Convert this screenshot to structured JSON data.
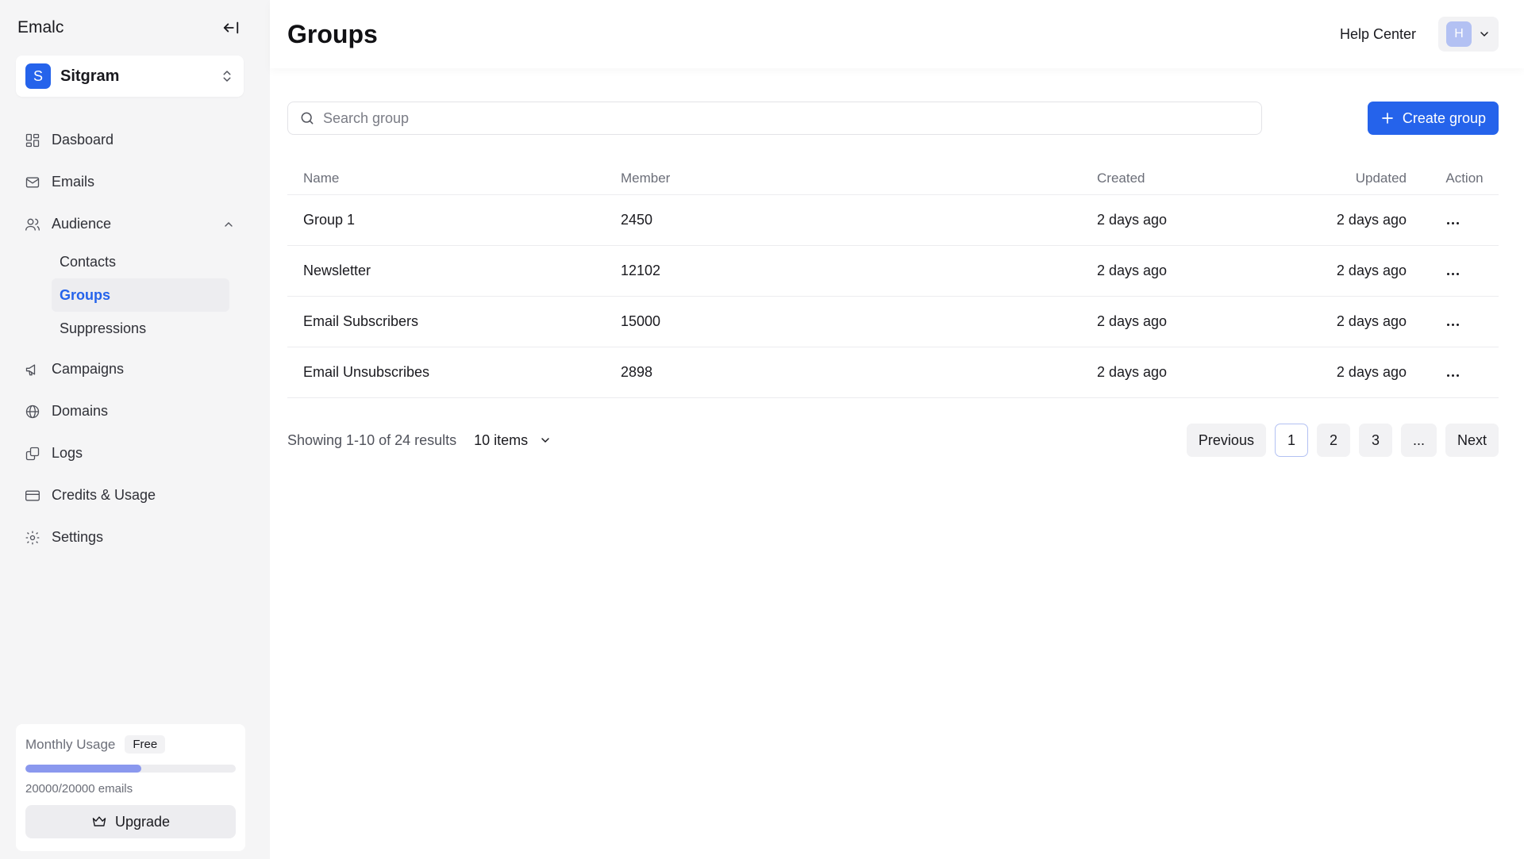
{
  "app": {
    "name": "Emalc"
  },
  "workspace": {
    "initial": "S",
    "name": "Sitgram"
  },
  "nav": {
    "dashboard": "Dasboard",
    "emails": "Emails",
    "audience": "Audience",
    "audience_sub": {
      "contacts": "Contacts",
      "groups": "Groups",
      "suppressions": "Suppressions"
    },
    "campaigns": "Campaigns",
    "domains": "Domains",
    "logs": "Logs",
    "credits": "Credits & Usage",
    "settings": "Settings"
  },
  "usage": {
    "title": "Monthly Usage",
    "plan": "Free",
    "progress_fraction": 0.55,
    "text": "20000/20000 emails",
    "upgrade_label": "Upgrade"
  },
  "header": {
    "title": "Groups",
    "help": "Help Center",
    "user_initial": "H"
  },
  "search": {
    "placeholder": "Search group"
  },
  "create_label": "Create group",
  "table": {
    "columns": {
      "name": "Name",
      "member": "Member",
      "created": "Created",
      "updated": "Updated",
      "action": "Action"
    },
    "rows": [
      {
        "name": "Group 1",
        "member": "2450",
        "created": "2 days ago",
        "updated": "2 days ago"
      },
      {
        "name": "Newsletter",
        "member": "12102",
        "created": "2 days ago",
        "updated": "2 days ago"
      },
      {
        "name": "Email Subscribers",
        "member": "15000",
        "created": "2 days ago",
        "updated": "2 days ago"
      },
      {
        "name": "Email Unsubscribes",
        "member": "2898",
        "created": "2 days ago",
        "updated": "2 days ago"
      }
    ]
  },
  "pagination": {
    "results": "Showing 1-10 of 24 results",
    "per_page": "10 items",
    "previous": "Previous",
    "pages": [
      "1",
      "2",
      "3",
      "..."
    ],
    "next": "Next"
  },
  "colors": {
    "accent": "#2563eb",
    "progress": "#8a98ee",
    "avatar": "#b3c1f3"
  }
}
